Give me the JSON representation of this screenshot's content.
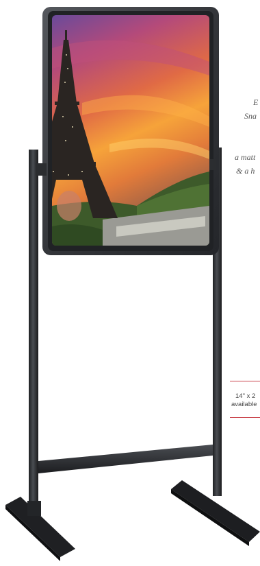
{
  "product": {
    "side_copy": [
      "E",
      "Sna",
      "a matt",
      "& a h"
    ],
    "spec_lines": [
      "14\" x 2",
      "available"
    ]
  },
  "colors": {
    "frame": "#3a3c40",
    "stand": "#2a2c2f",
    "accent_line": "#c9424a"
  },
  "icons": {
    "poster": "eiffel-tower-sunset-poster",
    "stand": "poster-floor-stand"
  }
}
